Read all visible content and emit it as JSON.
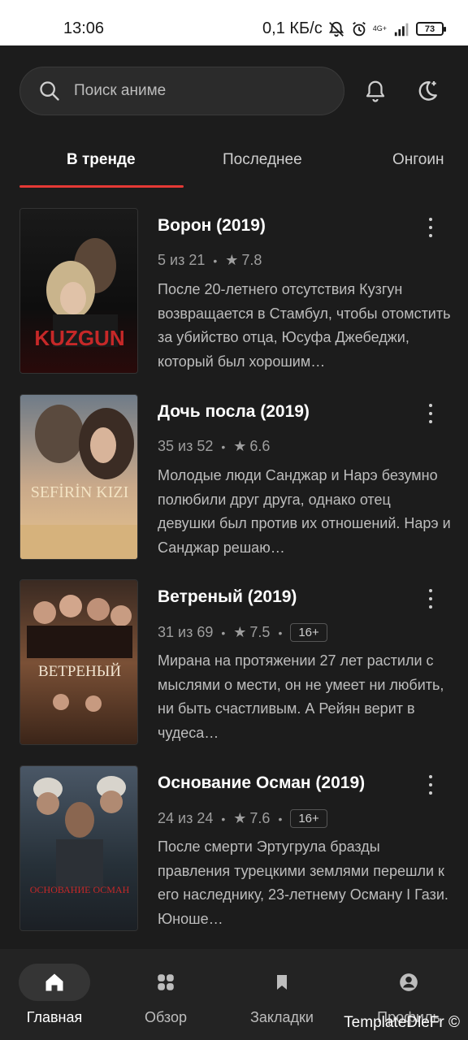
{
  "status": {
    "time": "13:06",
    "speed": "0,1 КБ/с",
    "network": "4G+",
    "battery": "73"
  },
  "search": {
    "placeholder": "Поиск аниме"
  },
  "icons": {
    "search": "search-icon",
    "notifications": "bell-icon",
    "theme": "moon-star-icon"
  },
  "tabs": [
    {
      "label": "В тренде"
    },
    {
      "label": "Последнее"
    },
    {
      "label": "Онгоин"
    }
  ],
  "items": [
    {
      "title": "Ворон (2019)",
      "episodes": "5 из 21",
      "rating": "7.8",
      "age": "",
      "description": "После 20-летнего отсутствия Кузгун возвращается в Стамбул, чтобы отомстить за убийство отца, Юсуфа Джебеджи, который был хорошим…",
      "poster_text": "KUZGUN"
    },
    {
      "title": "Дочь посла (2019)",
      "episodes": "35 из 52",
      "rating": "6.6",
      "age": "",
      "description": "Молодые люди Санджар и Нарэ безумно полюбили друг друга, однако отец девушки был против их отношений. Нарэ и Санджар решаю…",
      "poster_text": "SEFİRİN KIZI"
    },
    {
      "title": "Ветреный (2019)",
      "episodes": "31 из 69",
      "rating": "7.5",
      "age": "16+",
      "description": "Мирана на протяжении 27 лет растили с мыслями о мести, он не умеет ни любить, ни быть счастливым. А Рейян верит в чудеса…",
      "poster_text": "ВЕТРЕНЫЙ"
    },
    {
      "title": "Основание Осман (2019)",
      "episodes": "24 из 24",
      "rating": "7.6",
      "age": "16+",
      "description": "После смерти Эртугрула бразды правления турецкими землями перешли к его наследнику, 23-летнему Осману I Гази. Юноше…",
      "poster_text": "ОСНОВАНИЕ ОСМАН"
    }
  ],
  "nav": [
    {
      "label": "Главная",
      "icon": "home-icon"
    },
    {
      "label": "Обзор",
      "icon": "grid-icon"
    },
    {
      "label": "Закладки",
      "icon": "bookmark-icon"
    },
    {
      "label": "Профиль",
      "icon": "profile-icon"
    }
  ],
  "watermark": "TemplateDleFr ©",
  "colors": {
    "accent": "#e53935",
    "background": "#1c1c1c",
    "nav_bg": "#232323"
  }
}
